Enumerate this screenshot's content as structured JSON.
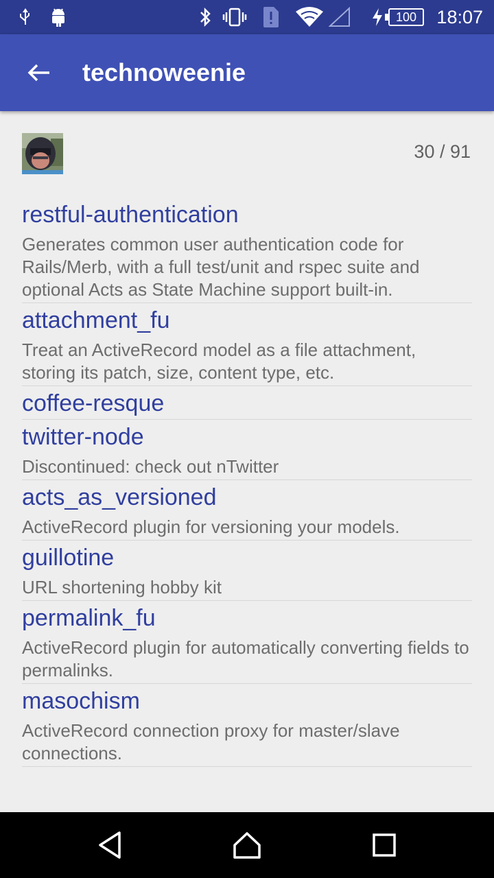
{
  "status_bar": {
    "time": "18:07",
    "battery": "100",
    "icons": [
      "usb-icon",
      "android-icon",
      "bluetooth-icon",
      "vibrate-icon",
      "sim-alert-icon",
      "wifi-icon",
      "signal-icon",
      "charging-icon",
      "battery-icon"
    ]
  },
  "app_bar": {
    "title": "technoweenie",
    "back_icon": "arrow-left-icon"
  },
  "header": {
    "counter": "30 / 91"
  },
  "repos": [
    {
      "name": "restful-authentication",
      "description": "Generates common user authentication code for Rails/Merb, with a full test/unit and rspec suite and optional Acts as State Machine support built-in."
    },
    {
      "name": "attachment_fu",
      "description": "Treat an ActiveRecord model as a file attachment, storing its patch, size, content type, etc."
    },
    {
      "name": "coffee-resque",
      "description": ""
    },
    {
      "name": "twitter-node",
      "description": "Discontinued:  check out nTwitter"
    },
    {
      "name": "acts_as_versioned",
      "description": "ActiveRecord plugin for versioning your models."
    },
    {
      "name": "guillotine",
      "description": "URL shortening hobby kit"
    },
    {
      "name": "permalink_fu",
      "description": "ActiveRecord plugin for automatically converting fields to permalinks."
    },
    {
      "name": "masochism",
      "description": "ActiveRecord connection proxy for master/slave connections."
    }
  ],
  "nav_bar": {
    "icons": [
      "back-triangle-icon",
      "home-icon",
      "recents-icon"
    ]
  }
}
